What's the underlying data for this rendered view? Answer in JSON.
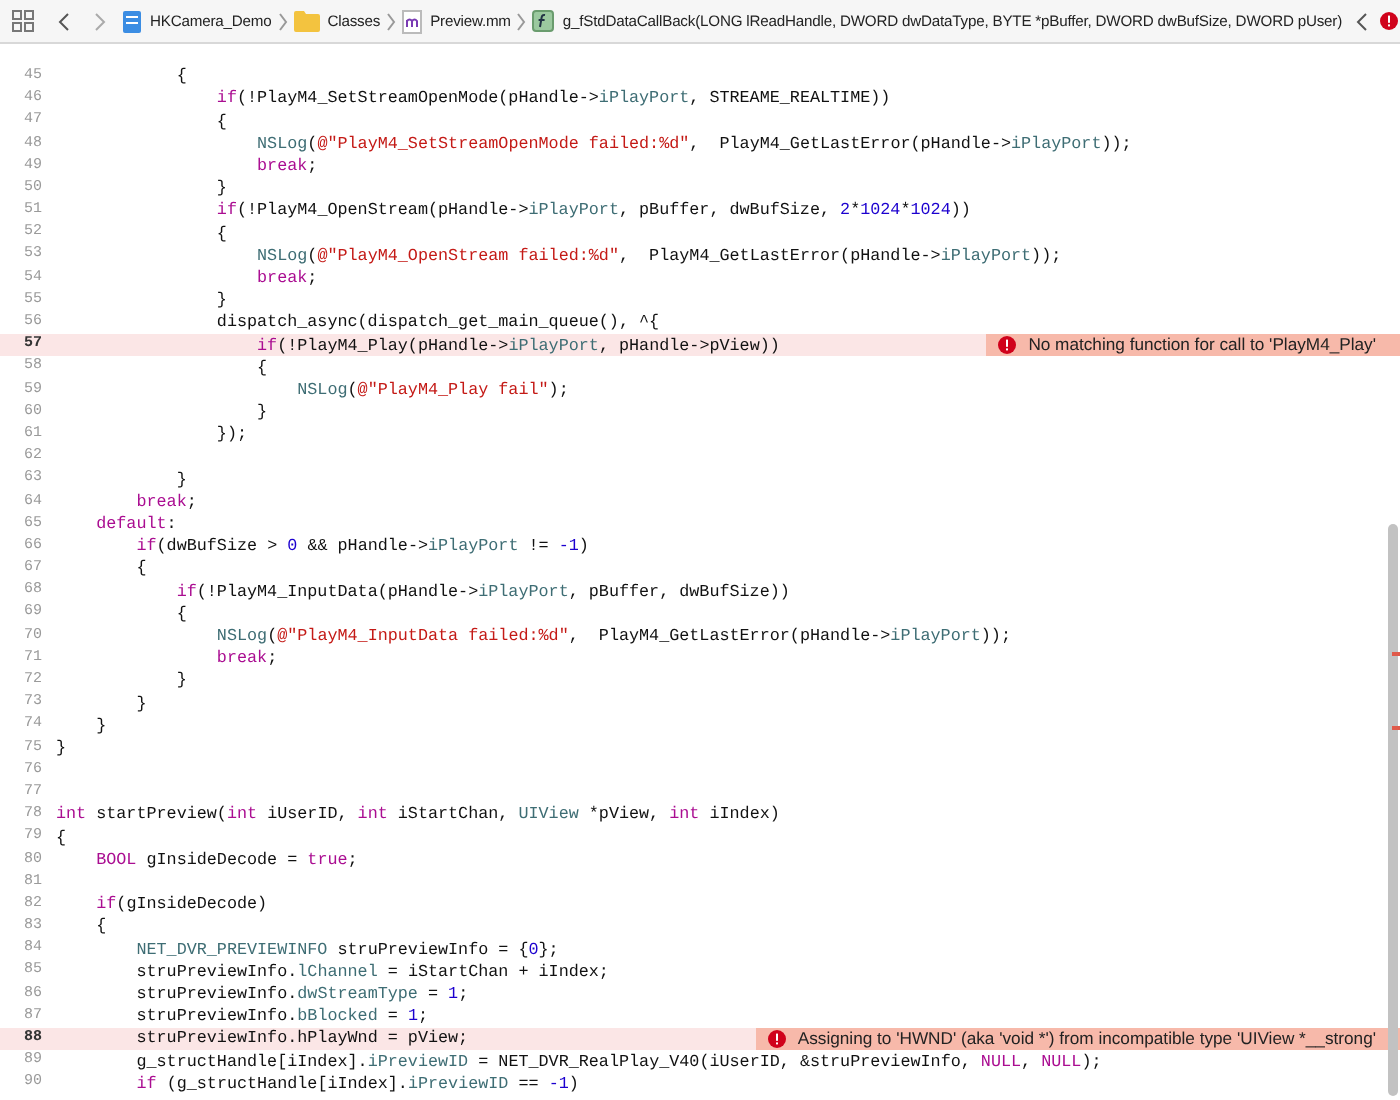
{
  "breadcrumb": [
    {
      "kind": "project",
      "text": "HKCamera_Demo"
    },
    {
      "kind": "folder",
      "text": "Classes"
    },
    {
      "kind": "file",
      "text": "Preview.mm"
    },
    {
      "kind": "function",
      "text": "g_fStdDataCallBack(LONG lReadHandle, DWORD dwDataType, BYTE *pBuffer, DWORD dwBufSize, DWORD pUser)"
    }
  ],
  "lines": [
    {
      "number": "45",
      "code": [
        {
          "kind": "plain",
          "text": "            {"
        }
      ]
    },
    {
      "number": "46",
      "code": [
        {
          "kind": "keyword",
          "text": "                if"
        },
        {
          "kind": "plain",
          "text": "(!PlayM4_SetStreamOpenMode(pHandle->"
        },
        {
          "kind": "ident",
          "text": "iPlayPort"
        },
        {
          "kind": "plain",
          "text": ", STREAME_REALTIME))"
        }
      ]
    },
    {
      "number": "47",
      "code": [
        {
          "kind": "plain",
          "text": "                {"
        }
      ]
    },
    {
      "number": "48",
      "code": [
        {
          "kind": "ident",
          "text": "                    NSLog"
        },
        {
          "kind": "plain",
          "text": "("
        },
        {
          "kind": "string",
          "text": "@\"PlayM4_SetStreamOpenMode failed:%d\""
        },
        {
          "kind": "plain",
          "text": ",  PlayM4_GetLastError(pHandle->"
        },
        {
          "kind": "ident",
          "text": "iPlayPort"
        },
        {
          "kind": "plain",
          "text": "));"
        }
      ]
    },
    {
      "number": "49",
      "code": [
        {
          "kind": "keyword",
          "text": "                    break"
        },
        {
          "kind": "plain",
          "text": ";"
        }
      ]
    },
    {
      "number": "50",
      "code": [
        {
          "kind": "plain",
          "text": "                }"
        }
      ]
    },
    {
      "number": "51",
      "code": [
        {
          "kind": "keyword",
          "text": "                if"
        },
        {
          "kind": "plain",
          "text": "(!PlayM4_OpenStream(pHandle->"
        },
        {
          "kind": "ident",
          "text": "iPlayPort"
        },
        {
          "kind": "plain",
          "text": ", pBuffer, dwBufSize, "
        },
        {
          "kind": "number",
          "text": "2"
        },
        {
          "kind": "plain",
          "text": "*"
        },
        {
          "kind": "number",
          "text": "1024"
        },
        {
          "kind": "plain",
          "text": "*"
        },
        {
          "kind": "number",
          "text": "1024"
        },
        {
          "kind": "plain",
          "text": "))"
        }
      ]
    },
    {
      "number": "52",
      "code": [
        {
          "kind": "plain",
          "text": "                {"
        }
      ]
    },
    {
      "number": "53",
      "code": [
        {
          "kind": "ident",
          "text": "                    NSLog"
        },
        {
          "kind": "plain",
          "text": "("
        },
        {
          "kind": "string",
          "text": "@\"PlayM4_OpenStream failed:%d\""
        },
        {
          "kind": "plain",
          "text": ",  PlayM4_GetLastError(pHandle->"
        },
        {
          "kind": "ident",
          "text": "iPlayPort"
        },
        {
          "kind": "plain",
          "text": "));"
        }
      ]
    },
    {
      "number": "54",
      "code": [
        {
          "kind": "keyword",
          "text": "                    break"
        },
        {
          "kind": "plain",
          "text": ";"
        }
      ]
    },
    {
      "number": "55",
      "code": [
        {
          "kind": "plain",
          "text": "                }"
        }
      ]
    },
    {
      "number": "56",
      "code": [
        {
          "kind": "plain",
          "text": "                dispatch_async(dispatch_get_main_queue(), ^{"
        }
      ]
    },
    {
      "number": "57",
      "code": [
        {
          "kind": "keyword",
          "text": "                    if"
        },
        {
          "kind": "plain",
          "text": "(!PlayM4_Play(pHandle->"
        },
        {
          "kind": "ident",
          "text": "iPlayPort"
        },
        {
          "kind": "plain",
          "text": ", pHandle->pView))"
        }
      ],
      "error": "No matching function for call to 'PlayM4_Play'"
    },
    {
      "number": "58",
      "code": [
        {
          "kind": "plain",
          "text": "                    {"
        }
      ]
    },
    {
      "number": "59",
      "code": [
        {
          "kind": "ident",
          "text": "                        NSLog"
        },
        {
          "kind": "plain",
          "text": "("
        },
        {
          "kind": "string",
          "text": "@\"PlayM4_Play fail\""
        },
        {
          "kind": "plain",
          "text": ");"
        }
      ]
    },
    {
      "number": "60",
      "code": [
        {
          "kind": "plain",
          "text": "                    }"
        }
      ]
    },
    {
      "number": "61",
      "code": [
        {
          "kind": "plain",
          "text": "                });"
        }
      ]
    },
    {
      "number": "62"
    },
    {
      "number": "63",
      "code": [
        {
          "kind": "plain",
          "text": "            }"
        }
      ]
    },
    {
      "number": "64",
      "code": [
        {
          "kind": "keyword",
          "text": "        break"
        },
        {
          "kind": "plain",
          "text": ";"
        }
      ]
    },
    {
      "number": "65",
      "code": [
        {
          "kind": "keyword",
          "text": "    default"
        },
        {
          "kind": "plain",
          "text": ":"
        }
      ]
    },
    {
      "number": "66",
      "code": [
        {
          "kind": "keyword",
          "text": "        if"
        },
        {
          "kind": "plain",
          "text": "(dwBufSize > "
        },
        {
          "kind": "number",
          "text": "0"
        },
        {
          "kind": "plain",
          "text": " && pHandle->"
        },
        {
          "kind": "ident",
          "text": "iPlayPort"
        },
        {
          "kind": "plain",
          "text": " != "
        },
        {
          "kind": "number",
          "text": "-1"
        },
        {
          "kind": "plain",
          "text": ")"
        }
      ]
    },
    {
      "number": "67",
      "code": [
        {
          "kind": "plain",
          "text": "        {"
        }
      ]
    },
    {
      "number": "68",
      "code": [
        {
          "kind": "keyword",
          "text": "            if"
        },
        {
          "kind": "plain",
          "text": "(!PlayM4_InputData(pHandle->"
        },
        {
          "kind": "ident",
          "text": "iPlayPort"
        },
        {
          "kind": "plain",
          "text": ", pBuffer, dwBufSize))"
        }
      ]
    },
    {
      "number": "69",
      "code": [
        {
          "kind": "plain",
          "text": "            {"
        }
      ]
    },
    {
      "number": "70",
      "code": [
        {
          "kind": "ident",
          "text": "                NSLog"
        },
        {
          "kind": "plain",
          "text": "("
        },
        {
          "kind": "string",
          "text": "@\"PlayM4_InputData failed:%d\""
        },
        {
          "kind": "plain",
          "text": ",  PlayM4_GetLastError(pHandle->"
        },
        {
          "kind": "ident",
          "text": "iPlayPort"
        },
        {
          "kind": "plain",
          "text": "));"
        }
      ]
    },
    {
      "number": "71",
      "code": [
        {
          "kind": "keyword",
          "text": "                break"
        },
        {
          "kind": "plain",
          "text": ";"
        }
      ]
    },
    {
      "number": "72",
      "code": [
        {
          "kind": "plain",
          "text": "            }"
        }
      ]
    },
    {
      "number": "73",
      "code": [
        {
          "kind": "plain",
          "text": "        }"
        }
      ]
    },
    {
      "number": "74",
      "code": [
        {
          "kind": "plain",
          "text": "    }"
        }
      ]
    },
    {
      "number": "75",
      "code": [
        {
          "kind": "plain",
          "text": "}"
        }
      ]
    },
    {
      "number": "76"
    },
    {
      "number": "77"
    },
    {
      "number": "78",
      "code": [
        {
          "kind": "keyword",
          "text": "int"
        },
        {
          "kind": "plain",
          "text": " startPreview("
        },
        {
          "kind": "keyword",
          "text": "int"
        },
        {
          "kind": "plain",
          "text": " iUserID, "
        },
        {
          "kind": "keyword",
          "text": "int"
        },
        {
          "kind": "plain",
          "text": " iStartChan, "
        },
        {
          "kind": "ident",
          "text": "UIView"
        },
        {
          "kind": "plain",
          "text": " *pView, "
        },
        {
          "kind": "keyword",
          "text": "int"
        },
        {
          "kind": "plain",
          "text": " iIndex)"
        }
      ]
    },
    {
      "number": "79",
      "code": [
        {
          "kind": "plain",
          "text": "{"
        }
      ]
    },
    {
      "number": "80",
      "code": [
        {
          "kind": "keyword",
          "text": "    BOOL"
        },
        {
          "kind": "plain",
          "text": " gInsideDecode = "
        },
        {
          "kind": "keyword",
          "text": "true"
        },
        {
          "kind": "plain",
          "text": ";"
        }
      ]
    },
    {
      "number": "81"
    },
    {
      "number": "82",
      "code": [
        {
          "kind": "keyword",
          "text": "    if"
        },
        {
          "kind": "plain",
          "text": "(gInsideDecode)"
        }
      ]
    },
    {
      "number": "83",
      "code": [
        {
          "kind": "plain",
          "text": "    {"
        }
      ]
    },
    {
      "number": "84",
      "code": [
        {
          "kind": "ident",
          "text": "        NET_DVR_PREVIEWINFO"
        },
        {
          "kind": "plain",
          "text": " struPreviewInfo = {"
        },
        {
          "kind": "number",
          "text": "0"
        },
        {
          "kind": "plain",
          "text": "};"
        }
      ]
    },
    {
      "number": "85",
      "code": [
        {
          "kind": "plain",
          "text": "        struPreviewInfo."
        },
        {
          "kind": "ident",
          "text": "lChannel"
        },
        {
          "kind": "plain",
          "text": " = iStartChan + iIndex;"
        }
      ]
    },
    {
      "number": "86",
      "code": [
        {
          "kind": "plain",
          "text": "        struPreviewInfo."
        },
        {
          "kind": "ident",
          "text": "dwStreamType"
        },
        {
          "kind": "plain",
          "text": " = "
        },
        {
          "kind": "number",
          "text": "1"
        },
        {
          "kind": "plain",
          "text": ";"
        }
      ]
    },
    {
      "number": "87",
      "code": [
        {
          "kind": "plain",
          "text": "        struPreviewInfo."
        },
        {
          "kind": "ident",
          "text": "bBlocked"
        },
        {
          "kind": "plain",
          "text": " = "
        },
        {
          "kind": "number",
          "text": "1"
        },
        {
          "kind": "plain",
          "text": ";"
        }
      ]
    },
    {
      "number": "88",
      "code": [
        {
          "kind": "plain",
          "text": "        struPreviewInfo.hPlayWnd = pView;"
        }
      ],
      "error": "Assigning to 'HWND' (aka 'void *') from incompatible type 'UIView *__strong'"
    },
    {
      "number": "89",
      "code": [
        {
          "kind": "plain",
          "text": "        g_structHandle[iIndex]."
        },
        {
          "kind": "ident",
          "text": "iPreviewID"
        },
        {
          "kind": "plain",
          "text": " = NET_DVR_RealPlay_V40(iUserID, &struPreviewInfo, "
        },
        {
          "kind": "keyword",
          "text": "NULL"
        },
        {
          "kind": "plain",
          "text": ", "
        },
        {
          "kind": "keyword",
          "text": "NULL"
        },
        {
          "kind": "plain",
          "text": ");"
        }
      ]
    },
    {
      "number": "90",
      "code": [
        {
          "kind": "keyword",
          "text": "        if"
        },
        {
          "kind": "plain",
          "text": " (g_structHandle[iIndex]."
        },
        {
          "kind": "ident",
          "text": "iPreviewID"
        },
        {
          "kind": "plain",
          "text": " == "
        },
        {
          "kind": "number",
          "text": "-1"
        },
        {
          "kind": "plain",
          "text": ")"
        }
      ]
    }
  ]
}
